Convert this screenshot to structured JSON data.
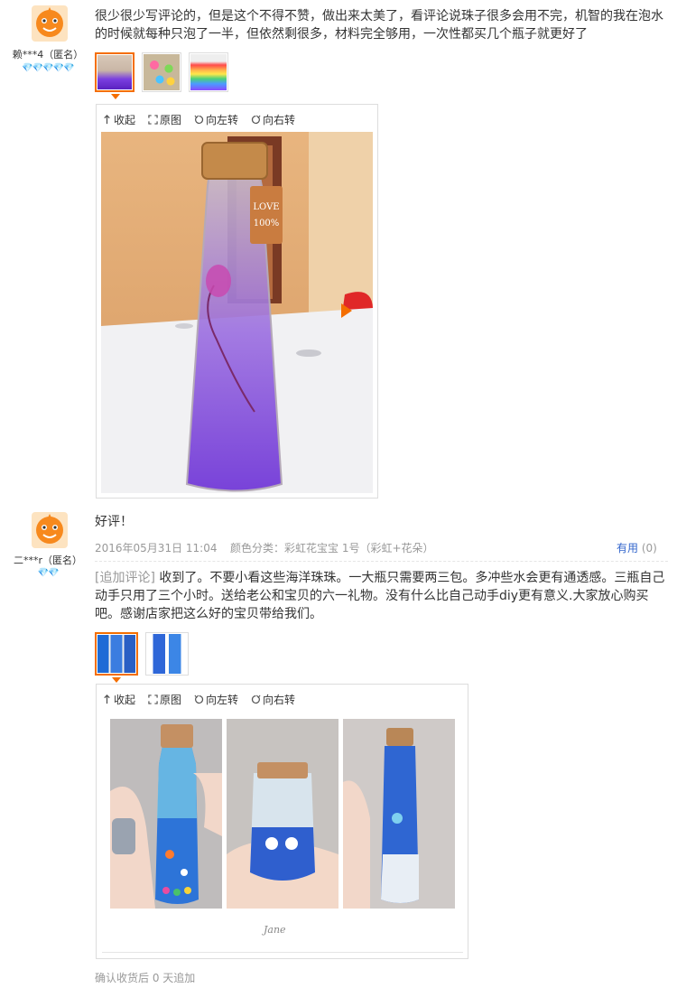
{
  "review1": {
    "user_name": "赖***4（匿名）",
    "level_badges": "💎💎💎💎💎",
    "text": "很少很少写评论的，但是这个不得不赞，做出来太美了，看评论说珠子很多会用不完，机智的我在泡水的时候就每种只泡了一半，但依然剩很多，材料完全够用，一次性都买几个瓶子就更好了",
    "thumbnails": [
      "thumb-purple-bottle",
      "thumb-colored-beads",
      "thumb-rainbow-bottle"
    ],
    "viewer": {
      "collapse": "收起",
      "original": "原图",
      "rotate_left": "向左转",
      "rotate_right": "向右转",
      "photo_tag_line1": "LOVE",
      "photo_tag_line2": "100%"
    }
  },
  "review2": {
    "user_name": "二***r（匿名）",
    "level_badges": "💎💎",
    "text": "好评！",
    "date": "2016年05月31日 11:04",
    "sku": "颜色分类：彩虹花宝宝 1号（彩虹+花朵）",
    "helpful_label": "有用",
    "helpful_count": "(0)",
    "append_tag": "[追加评论]",
    "append_text": "收到了。不要小看这些海洋珠珠。一大瓶只需要两三包。多冲些水会更有通透感。三瓶自己动手只用了三个小时。送给老公和宝贝的六一礼物。没有什么比自己动手diy更有意义.大家放心购买吧。感谢店家把这么好的宝贝带给我们。",
    "thumbnails": [
      "thumb-three-bottles",
      "thumb-two-bottles"
    ],
    "viewer": {
      "collapse": "收起",
      "original": "原图",
      "rotate_left": "向左转",
      "rotate_right": "向右转",
      "signature": "Jane"
    },
    "append_prompt": "确认收货后 0 天追加"
  },
  "colors": {
    "accent": "#f46e00",
    "link": "#3366cc",
    "muted": "#999999"
  }
}
